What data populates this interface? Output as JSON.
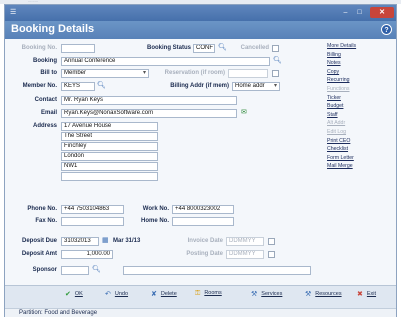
{
  "window": {
    "title": "Booking Details",
    "app_icon": "document-icon",
    "header_bg": "#5f88bf"
  },
  "form": {
    "booking_no": {
      "label": "Booking No.",
      "value": ""
    },
    "booking_status": {
      "label": "Booking Status",
      "value": "CONF"
    },
    "cancelled": {
      "label": "Cancelled"
    },
    "booking": {
      "label": "Booking",
      "value": "Annual Conference"
    },
    "bill_to": {
      "label": "Bill to",
      "value": "Member"
    },
    "reservation": {
      "label": "Reservation (if room)",
      "value": ""
    },
    "member_no": {
      "label": "Member No.",
      "value": "KEYS"
    },
    "billing_addr": {
      "label": "Billing Addr (if mem)",
      "value": "Home addr"
    },
    "contact": {
      "label": "Contact",
      "value": "Mr. Ryan Keys"
    },
    "email": {
      "label": "Email",
      "value": "Ryan.Keys@NonaxSoftware.com"
    },
    "address": {
      "label": "Address",
      "lines": [
        "17 Avenue House",
        "The Street",
        "Finchley",
        "London",
        "NW1",
        ""
      ]
    },
    "phone": {
      "label": "Phone No.",
      "value": "+44 7503104863"
    },
    "work": {
      "label": "Work No.",
      "value": "+44 8000323002"
    },
    "fax": {
      "label": "Fax No.",
      "value": ""
    },
    "home": {
      "label": "Home No.",
      "value": ""
    },
    "deposit_due": {
      "label": "Deposit Due",
      "value": "31032013",
      "date_text": "Mar 31/13"
    },
    "invoice_date": {
      "label": "Invoice Date",
      "value": "DDMMYY"
    },
    "deposit_amt": {
      "label": "Deposit Amt",
      "value": "1,000.00"
    },
    "posting_date": {
      "label": "Posting Date",
      "value": "DDMMYY"
    },
    "sponsor": {
      "label": "Sponsor",
      "value": "",
      "extra": ""
    }
  },
  "side_menu": [
    {
      "label": "More Details",
      "enabled": true
    },
    {
      "label": "Billing",
      "enabled": true
    },
    {
      "label": "Notes",
      "enabled": true
    },
    {
      "label": "Copy",
      "enabled": true
    },
    {
      "label": "Recurring",
      "enabled": true
    },
    {
      "label": "Functions",
      "enabled": false
    },
    {
      "label": "Ticker",
      "enabled": true
    },
    {
      "label": "Budget",
      "enabled": true
    },
    {
      "label": "Staff",
      "enabled": true
    },
    {
      "label": "Alt Addr",
      "enabled": false
    },
    {
      "label": "Edit Log",
      "enabled": false
    },
    {
      "label": "Print CEO",
      "enabled": true
    },
    {
      "label": "Checklist",
      "enabled": true
    },
    {
      "label": "Form Letter",
      "enabled": true
    },
    {
      "label": "Mail Merge",
      "enabled": true
    }
  ],
  "footer": {
    "buttons": [
      {
        "label": "OK",
        "icon": "check-icon",
        "color": "#2e9a3a"
      },
      {
        "label": "Undo",
        "icon": "undo-icon",
        "color": "#3a6db3"
      },
      {
        "label": "Delete",
        "icon": "delete-icon",
        "color": "#3a6db3"
      },
      {
        "label": "Rooms",
        "icon": "key-icon",
        "color": "#d9a21b"
      },
      {
        "label": "Services",
        "icon": "services-icon",
        "color": "#3a6db3"
      },
      {
        "label": "Resources",
        "icon": "resources-icon",
        "color": "#3a6db3"
      },
      {
        "label": "Exit",
        "icon": "exit-icon",
        "color": "#c8453a"
      }
    ]
  },
  "status": {
    "text": "Partition: Food and Beverage"
  }
}
